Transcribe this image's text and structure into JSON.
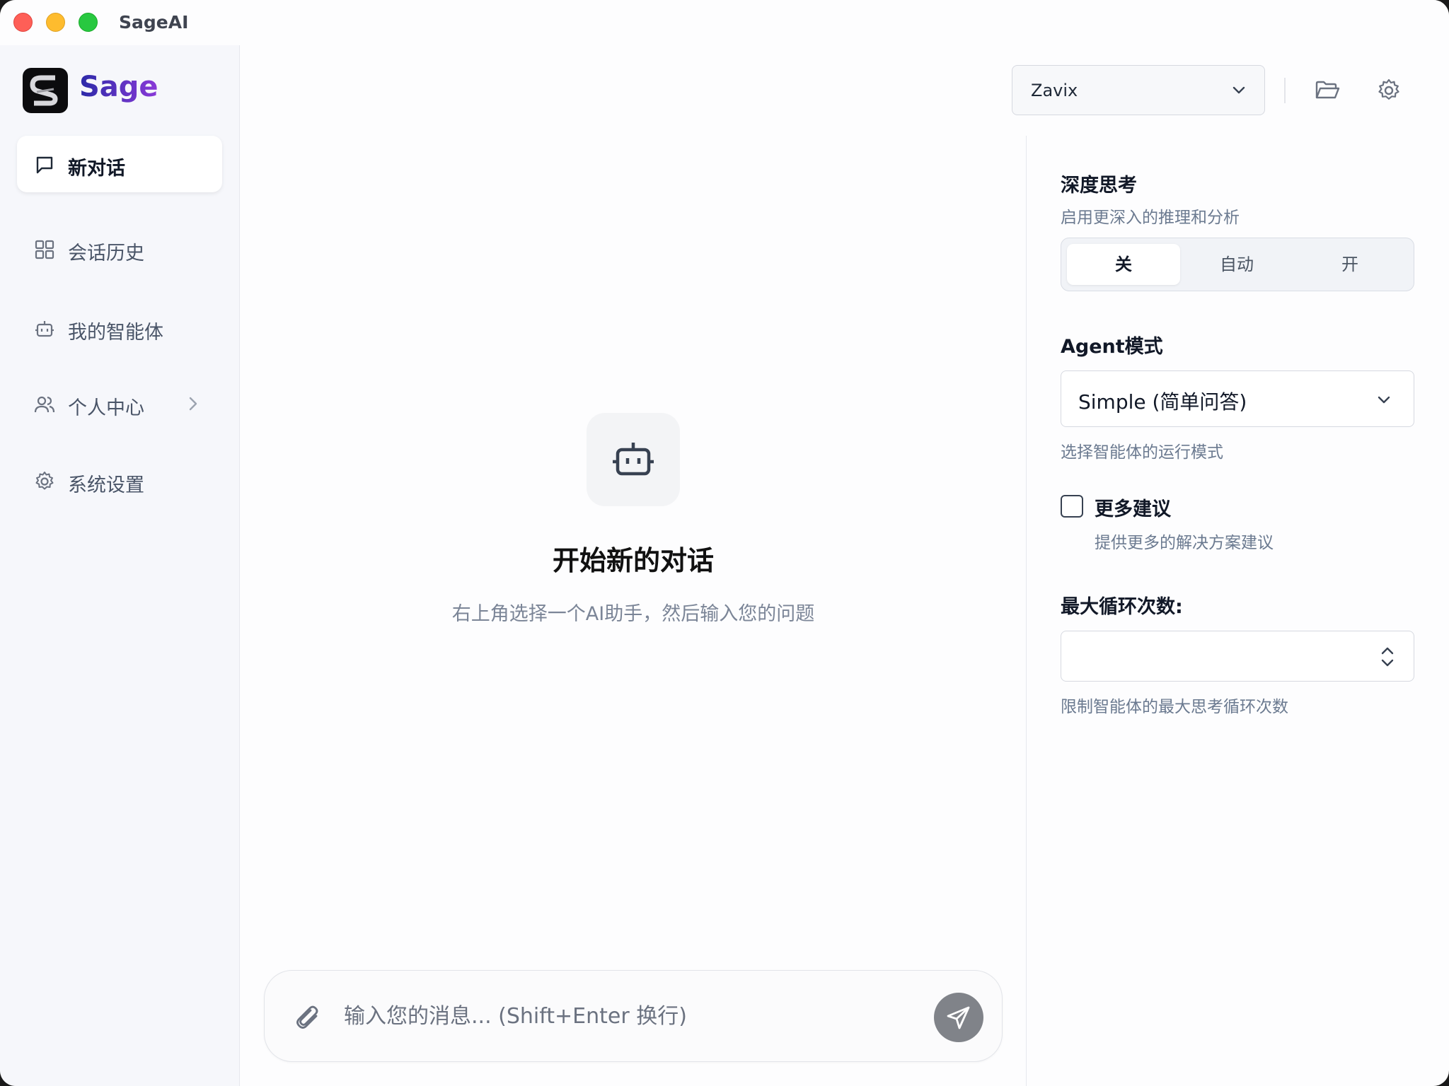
{
  "window": {
    "title": "SageAI"
  },
  "brand": {
    "name": "Sage"
  },
  "sidebar": {
    "items": [
      {
        "label": "新对话",
        "icon": "chat-bubble-icon",
        "active": true
      },
      {
        "label": "会话历史",
        "icon": "grid-icon",
        "active": false
      },
      {
        "label": "我的智能体",
        "icon": "robot-icon",
        "active": false
      },
      {
        "label": "个人中心",
        "icon": "users-icon",
        "active": false,
        "expandable": true
      },
      {
        "label": "系统设置",
        "icon": "gear-icon",
        "active": false
      }
    ]
  },
  "topbar": {
    "agent_selected": "Zavix",
    "icons": [
      "folder-open-icon",
      "settings-gear-icon"
    ]
  },
  "empty_state": {
    "icon": "robot-icon",
    "title": "开始新的对话",
    "subtitle": "右上角选择一个AI助手，然后输入您的问题"
  },
  "composer": {
    "placeholder": "输入您的消息... (Shift+Enter 换行)",
    "value": ""
  },
  "settings_panel": {
    "deep_thinking": {
      "title": "深度思考",
      "description": "启用更深入的推理和分析",
      "options": [
        "关",
        "自动",
        "开"
      ],
      "selected": "关"
    },
    "agent_mode": {
      "title": "Agent模式",
      "selected": "Simple (简单问答)",
      "description": "选择智能体的运行模式"
    },
    "more_suggestions": {
      "label": "更多建议",
      "description": "提供更多的解决方案建议",
      "checked": false
    },
    "max_loops": {
      "title": "最大循环次数:",
      "value": "",
      "description": "限制智能体的最大思考循环次数"
    }
  },
  "colors": {
    "accent_gradient_start": "#2b2aa8",
    "accent_gradient_end": "#8b3ad8",
    "send_button": "#808389"
  }
}
